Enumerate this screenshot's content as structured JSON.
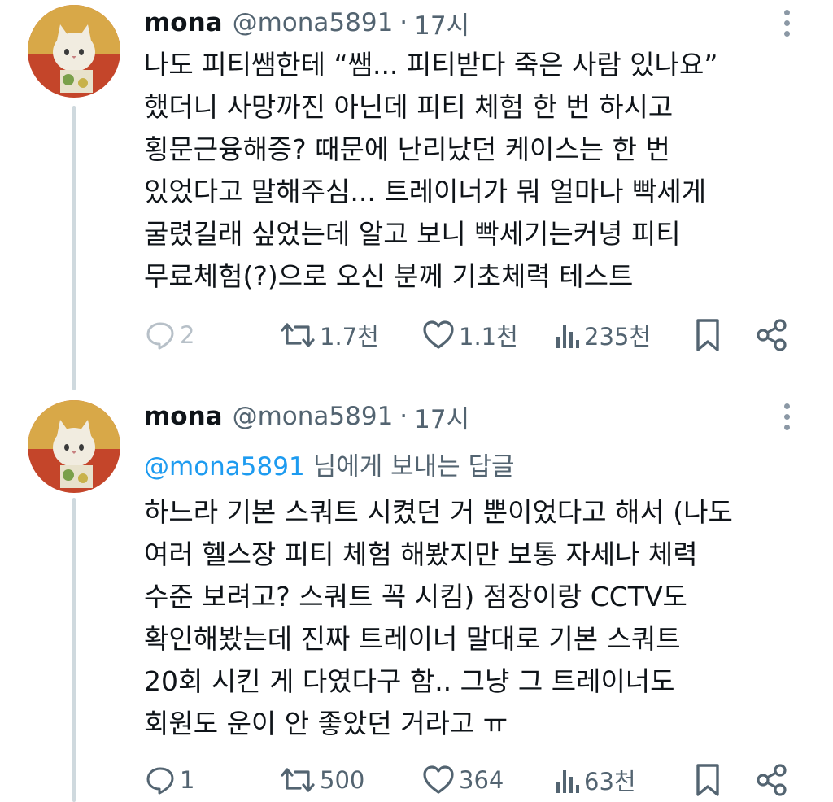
{
  "tweets": [
    {
      "name": "mona",
      "handle": "@mona5891",
      "separator": "·",
      "time": "17시",
      "lines": [
        "나도 피티쌤한테 “쌤... 피티받다 죽은 사람 있나요”",
        "했더니 사망까진 아닌데 피티 체험 한 번 하시고",
        "횡문근융해증? 때문에 난리났던 케이스는 한 번",
        "있었다고 말해주심... 트레이너가 뭐 얼마나 빡세게",
        "굴렸길래 싶었는데 알고 보니 빡세기는커녕 피티",
        "무료체험(?)으로 오신 분께 기초체력 테스트"
      ],
      "stats": {
        "replies": "2",
        "retweets": "1.7천",
        "likes": "1.1천",
        "views": "235천"
      }
    },
    {
      "name": "mona",
      "handle": "@mona5891",
      "separator": "·",
      "time": "17시",
      "reply_to": {
        "mention": "@mona5891",
        "text": "님에게 보내는 답글"
      },
      "lines": [
        "하느라 기본 스쿼트 시켰던 거 뿐이었다고 해서 (나도",
        "여러 헬스장 피티 체험 해봤지만 보통 자세나 체력",
        "수준 보려고? 스쿼트 꼭 시킴) 점장이랑 CCTV도",
        "확인해봤는데 진짜 트레이너 말대로 기본 스쿼트",
        "20회 시킨 게 다였다구 함.. 그냥 그 트레이너도",
        "회원도 운이 안 좋았던 거라고 ㅠ"
      ],
      "stats": {
        "replies": "1",
        "retweets": "500",
        "likes": "364",
        "views": "63천"
      }
    }
  ],
  "icons": {
    "reply": "reply-bubble-icon",
    "retweet": "retweet-icon",
    "like": "heart-icon",
    "views": "bar-chart-icon",
    "bookmark": "bookmark-icon",
    "share": "share-icon",
    "more": "more-dots-icon"
  },
  "colors": {
    "text": "#0f1419",
    "secondary": "#536471",
    "link": "#1d9bf0",
    "thread_line": "#cfd9de"
  }
}
